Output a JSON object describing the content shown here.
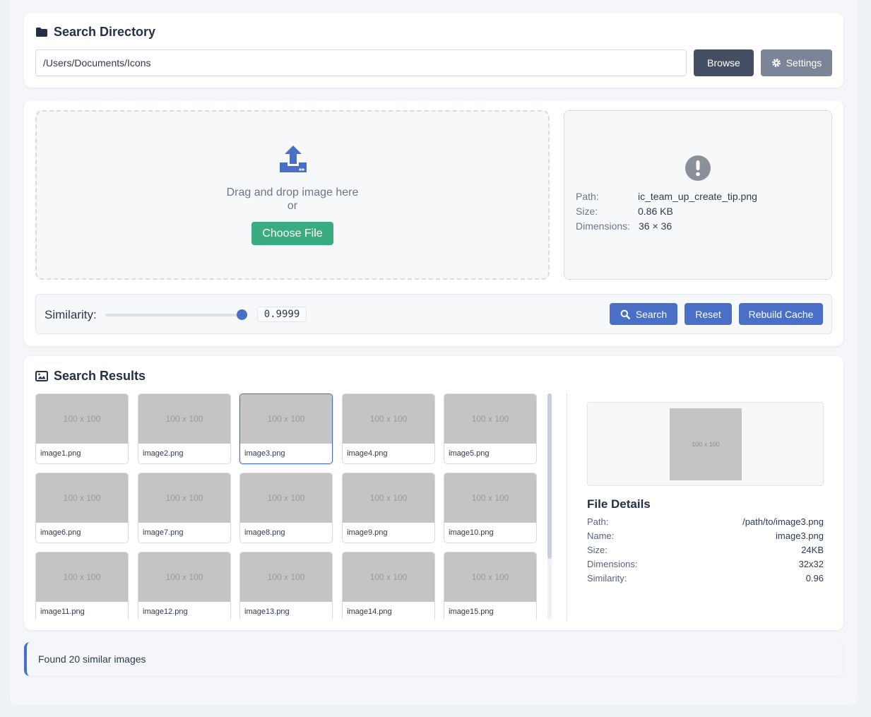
{
  "directory": {
    "title": "Search Directory",
    "path_value": "/Users/Documents/Icons",
    "browse_label": "Browse",
    "settings_label": "Settings"
  },
  "upload": {
    "drop_text": "Drag and drop image here",
    "or_text": "or",
    "choose_label": "Choose File"
  },
  "query_info": {
    "icon": "exclamation-circle-icon",
    "path_label": "Path:",
    "path_value": "ic_team_up_create_tip.png",
    "size_label": "Size:",
    "size_value": "0.86 KB",
    "dims_label": "Dimensions:",
    "dims_value": "36 × 36"
  },
  "similarity": {
    "label": "Similarity:",
    "value": "0.9999",
    "slider_level": 0.9999,
    "search_label": "Search",
    "reset_label": "Reset",
    "rebuild_label": "Rebuild Cache"
  },
  "results": {
    "title": "Search Results",
    "placeholder_text": "100 x 100",
    "items": [
      {
        "name": "image1.png"
      },
      {
        "name": "image2.png"
      },
      {
        "name": "image3.png",
        "selected": true
      },
      {
        "name": "image4.png"
      },
      {
        "name": "image5.png"
      },
      {
        "name": "image6.png"
      },
      {
        "name": "image7.png"
      },
      {
        "name": "image8.png"
      },
      {
        "name": "image9.png"
      },
      {
        "name": "image10.png"
      },
      {
        "name": "image11.png"
      },
      {
        "name": "image12.png"
      },
      {
        "name": "image13.png"
      },
      {
        "name": "image14.png"
      },
      {
        "name": "image15.png"
      }
    ]
  },
  "details": {
    "preview_text": "100 x 100",
    "title": "File Details",
    "rows": [
      {
        "label": "Path:",
        "value": "/path/to/image3.png"
      },
      {
        "label": "Name:",
        "value": "image3.png"
      },
      {
        "label": "Size:",
        "value": "24KB"
      },
      {
        "label": "Dimensions:",
        "value": "32x32"
      },
      {
        "label": "Similarity:",
        "value": "0.96"
      }
    ]
  },
  "status": {
    "text": "Found 20 similar images"
  },
  "colors": {
    "primary": "#4a6fc7",
    "success": "#3bab82",
    "dark": "#454f63",
    "muted": "#7c8597"
  }
}
